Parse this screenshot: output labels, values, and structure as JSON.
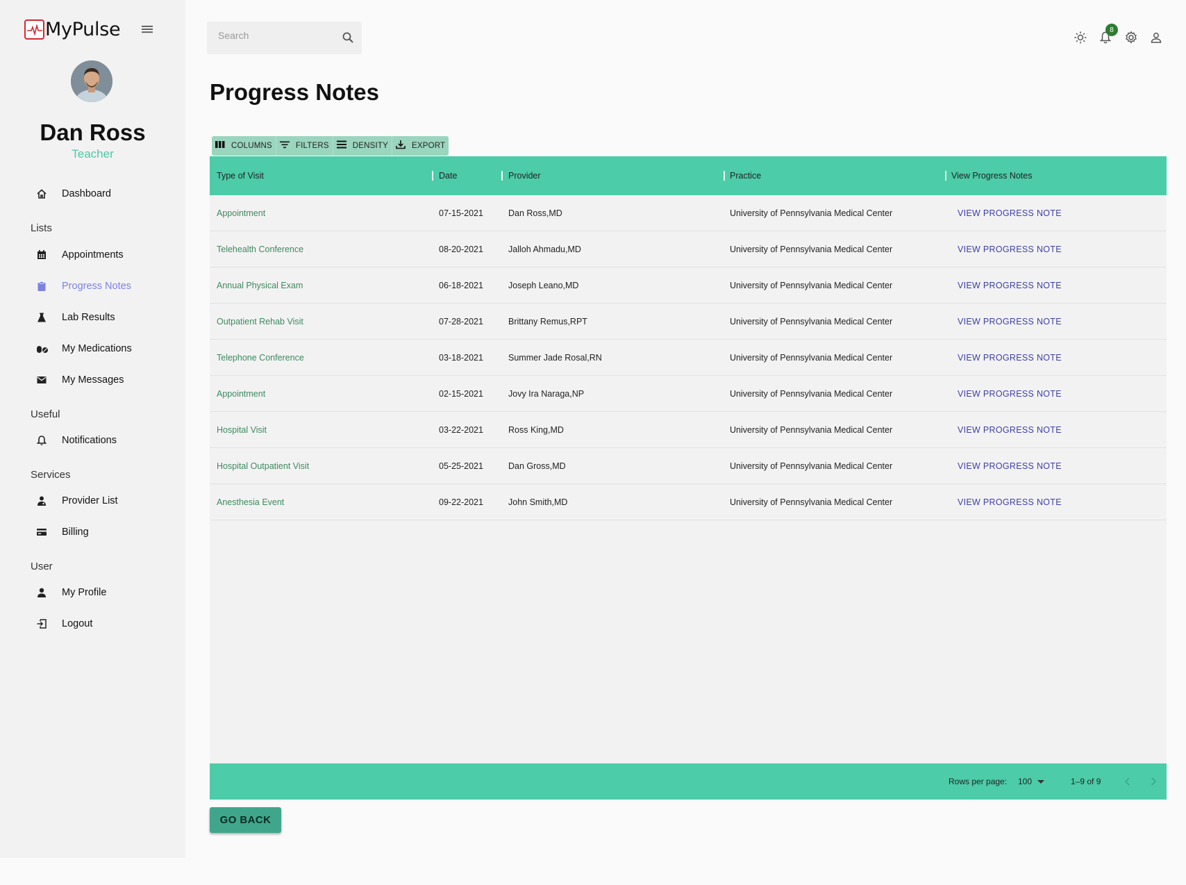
{
  "app": {
    "name": "MyPulse"
  },
  "user": {
    "name": "Dan Ross",
    "role": "Teacher"
  },
  "sidebar": {
    "sections": [
      {
        "label": "Lists"
      },
      {
        "label": "Useful"
      },
      {
        "label": "Services"
      },
      {
        "label": "User"
      }
    ],
    "items": [
      {
        "label": "Dashboard",
        "icon": "home-icon"
      },
      {
        "label": "Appointments",
        "icon": "calendar-icon"
      },
      {
        "label": "Progress Notes",
        "icon": "clipboard-icon",
        "active": true
      },
      {
        "label": "Lab Results",
        "icon": "flask-icon"
      },
      {
        "label": "My Medications",
        "icon": "pills-icon"
      },
      {
        "label": "My Messages",
        "icon": "mail-icon"
      },
      {
        "label": "Notifications",
        "icon": "bell-icon"
      },
      {
        "label": "Provider List",
        "icon": "doctor-icon"
      },
      {
        "label": "Billing",
        "icon": "credit-card-icon"
      },
      {
        "label": "My Profile",
        "icon": "person-icon"
      },
      {
        "label": "Logout",
        "icon": "logout-icon"
      }
    ]
  },
  "topbar": {
    "search_placeholder": "Search",
    "notification_count": "8"
  },
  "page": {
    "title": "Progress Notes"
  },
  "toolbar": {
    "columns": "COLUMNS",
    "filters": "FILTERS",
    "density": "DENSITY",
    "export": "EXPORT"
  },
  "table": {
    "headers": [
      "Type of Visit",
      "Date",
      "Provider",
      "Practice",
      "View Progress Notes"
    ],
    "rows": [
      {
        "type": "Appointment",
        "date": "07-15-2021",
        "provider": "Dan Ross,MD",
        "practice": "University of Pennsylvania Medical Center",
        "action": "VIEW PROGRESS NOTE"
      },
      {
        "type": "Telehealth Conference",
        "date": "08-20-2021",
        "provider": "Jalloh Ahmadu,MD",
        "practice": "University of Pennsylvania Medical Center",
        "action": "VIEW PROGRESS NOTE"
      },
      {
        "type": "Annual Physical Exam",
        "date": "06-18-2021",
        "provider": "Joseph Leano,MD",
        "practice": "University of Pennsylvania Medical Center",
        "action": "VIEW PROGRESS NOTE"
      },
      {
        "type": "Outpatient Rehab Visit",
        "date": "07-28-2021",
        "provider": "Brittany Remus,RPT",
        "practice": "University of Pennsylvania Medical Center",
        "action": "VIEW PROGRESS NOTE"
      },
      {
        "type": "Telephone Conference",
        "date": "03-18-2021",
        "provider": "Summer Jade Rosal,RN",
        "practice": "University of Pennsylvania Medical Center",
        "action": "VIEW PROGRESS NOTE"
      },
      {
        "type": "Appointment",
        "date": "02-15-2021",
        "provider": "Jovy Ira Naraga,NP",
        "practice": "University of Pennsylvania Medical Center",
        "action": "VIEW PROGRESS NOTE"
      },
      {
        "type": "Hospital Visit",
        "date": "03-22-2021",
        "provider": "Ross King,MD",
        "practice": "University of Pennsylvania Medical Center",
        "action": "VIEW PROGRESS NOTE"
      },
      {
        "type": "Hospital Outpatient Visit",
        "date": "05-25-2021",
        "provider": "Dan Gross,MD",
        "practice": "University of Pennsylvania Medical Center",
        "action": "VIEW PROGRESS NOTE"
      },
      {
        "type": "Anesthesia Event",
        "date": "09-22-2021",
        "provider": "John Smith,MD",
        "practice": "University of Pennsylvania Medical Center",
        "action": "VIEW PROGRESS NOTE"
      }
    ],
    "footer": {
      "rows_per_page_label": "Rows per page:",
      "rows_per_page_value": "100",
      "range_text": "1–9 of 9"
    }
  },
  "actions": {
    "go_back": "GO BACK"
  },
  "colors": {
    "accent": "#4ccca9",
    "active_nav": "#7b82e0",
    "link": "#3a3fa9",
    "visit_type": "#3b8a5c",
    "badge": "#2e7d32",
    "logo": "#d8262f"
  }
}
